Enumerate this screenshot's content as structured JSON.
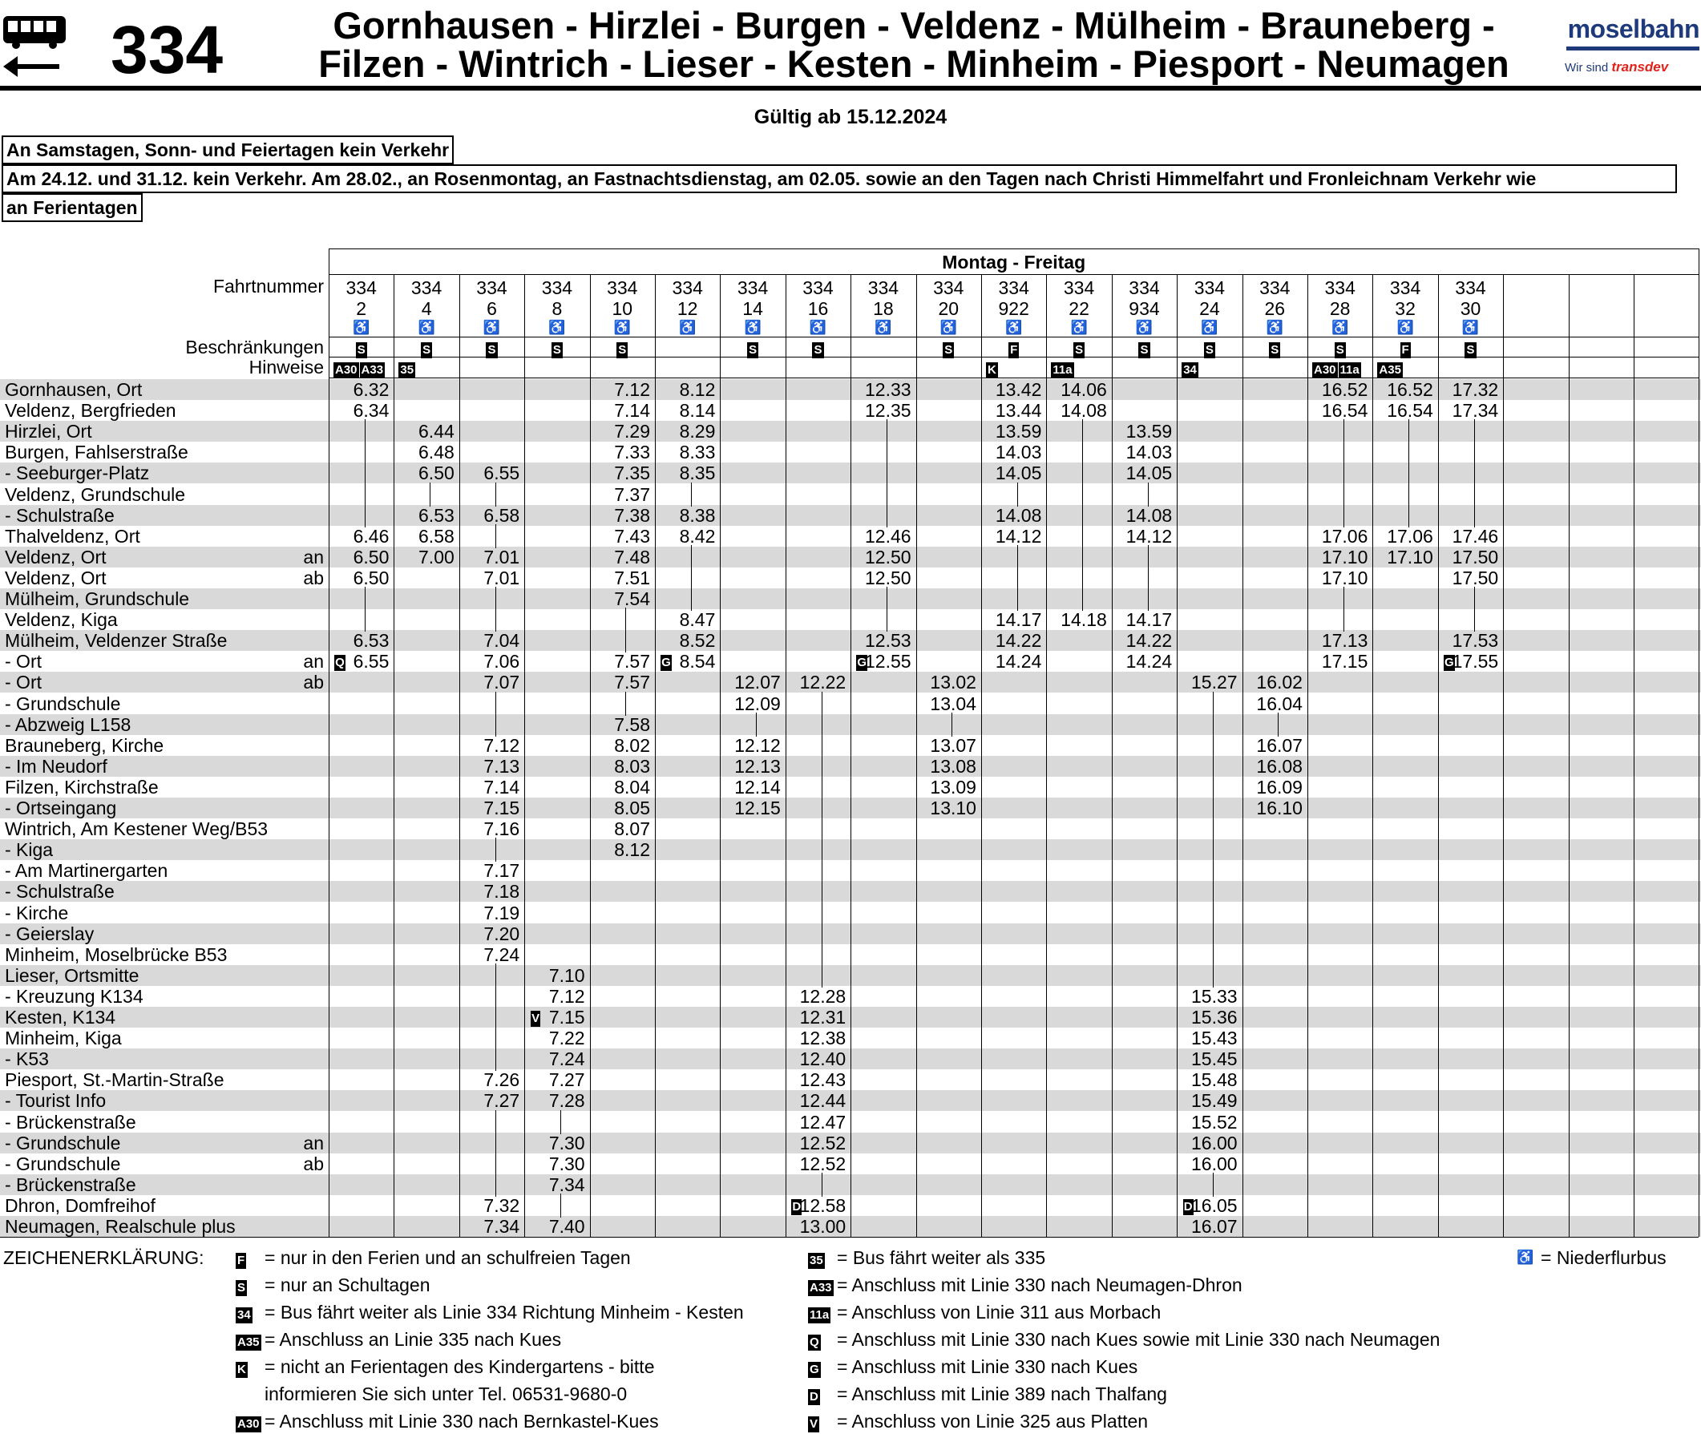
{
  "header": {
    "line_number": "334",
    "route_line1": "Gornhausen - Hirzlei - Burgen - Veldenz - Mülheim - Brauneberg -",
    "route_line2": "Filzen - Wintrich - Lieser - Kesten - Minheim - Piesport - Neumagen",
    "logo_main": "moselbahn",
    "logo_sub": "Wir sind",
    "logo_brand": "transdev",
    "brand_color": "#1f3a7a",
    "accent_color": "#e2231a",
    "icon": "bus-arrow-left-icon"
  },
  "validity": "Gültig ab 15.12.2024",
  "notes": [
    "An Samstagen, Sonn- und Feiertagen kein Verkehr",
    "Am 24.12. und 31.12. kein Verkehr. Am 28.02., an Rosenmontag, an Fastnachtsdienstag, am 02.05. sowie an den Tagen nach Christi Himmelfahrt und Fronleichnam Verkehr wie",
    "an Ferientagen"
  ],
  "timetable": {
    "day_header": "Montag - Freitag",
    "row_labels": {
      "fahrtnummer": "Fahrtnummer",
      "beschraenkungen": "Beschränkungen",
      "hinweise": "Hinweise"
    },
    "lines": [
      "334",
      "334",
      "334",
      "334",
      "334",
      "334",
      "334",
      "334",
      "334",
      "334",
      "334",
      "334",
      "334",
      "334",
      "334",
      "334",
      "334",
      "334"
    ],
    "trips": [
      "2",
      "4",
      "6",
      "8",
      "10",
      "12",
      "14",
      "16",
      "18",
      "20",
      "922",
      "22",
      "934",
      "24",
      "26",
      "28",
      "32",
      "30"
    ],
    "restrictions": [
      "S",
      "S",
      "S",
      "S",
      "S",
      "",
      "S",
      "S",
      "",
      "S",
      "F",
      "S",
      "S",
      "S",
      "S",
      "S",
      "F",
      "S"
    ],
    "hints": [
      [
        "A30",
        "A33"
      ],
      [
        "35"
      ],
      [],
      [],
      [],
      [],
      [],
      [],
      [],
      [],
      [
        "K"
      ],
      [
        "11a"
      ],
      [],
      [
        "34"
      ],
      [],
      [
        "A30",
        "11a"
      ],
      [
        "A35"
      ],
      []
    ],
    "stops": [
      {
        "name": "Gornhausen, Ort",
        "times": [
          "6.32",
          "",
          "",
          "",
          "7.12",
          "8.12",
          "",
          "",
          "12.33",
          "",
          "13.42",
          "14.06",
          "",
          "",
          "",
          "16.52",
          "16.52",
          "17.32"
        ]
      },
      {
        "name": "Veldenz, Bergfrieden",
        "times": [
          "6.34",
          "",
          "",
          "",
          "7.14",
          "8.14",
          "",
          "",
          "12.35",
          "",
          "13.44",
          "14.08",
          "",
          "",
          "",
          "16.54",
          "16.54",
          "17.34"
        ]
      },
      {
        "name": "Hirzlei, Ort",
        "times": [
          "",
          "6.44",
          "",
          "",
          "7.29",
          "8.29",
          "",
          "",
          "",
          "",
          "13.59",
          "",
          "13.59",
          "",
          "",
          "",
          "",
          ""
        ]
      },
      {
        "name": "Burgen, Fahlserstraße",
        "times": [
          "",
          "6.48",
          "",
          "",
          "7.33",
          "8.33",
          "",
          "",
          "",
          "",
          "14.03",
          "",
          "14.03",
          "",
          "",
          "",
          "",
          ""
        ]
      },
      {
        "name": "- Seeburger-Platz",
        "times": [
          "",
          "6.50",
          "6.55",
          "",
          "7.35",
          "8.35",
          "",
          "",
          "",
          "",
          "14.05",
          "",
          "14.05",
          "",
          "",
          "",
          "",
          ""
        ]
      },
      {
        "name": "Veldenz, Grundschule",
        "times": [
          "",
          "",
          "",
          "",
          "7.37",
          "",
          "",
          "",
          "",
          "",
          "",
          "",
          "",
          "",
          "",
          "",
          "",
          ""
        ]
      },
      {
        "name": "- Schulstraße",
        "times": [
          "",
          "6.53",
          "6.58",
          "",
          "7.38",
          "8.38",
          "",
          "",
          "",
          "",
          "14.08",
          "",
          "14.08",
          "",
          "",
          "",
          "",
          ""
        ]
      },
      {
        "name": "Thalveldenz, Ort",
        "times": [
          "6.46",
          "6.58",
          "",
          "",
          "7.43",
          "8.42",
          "",
          "",
          "12.46",
          "",
          "14.12",
          "",
          "14.12",
          "",
          "",
          "17.06",
          "17.06",
          "17.46"
        ]
      },
      {
        "name": "Veldenz, Ort",
        "suffix": "an",
        "times": [
          "6.50",
          "7.00",
          "7.01",
          "",
          "7.48",
          "",
          "",
          "",
          "12.50",
          "",
          "",
          "",
          "",
          "",
          "",
          "17.10",
          "17.10",
          "17.50"
        ]
      },
      {
        "name": "Veldenz, Ort",
        "suffix": "ab",
        "times": [
          "6.50",
          "",
          "7.01",
          "",
          "7.51",
          "",
          "",
          "",
          "12.50",
          "",
          "",
          "",
          "",
          "",
          "",
          "17.10",
          "",
          "17.50"
        ]
      },
      {
        "name": "Mülheim, Grundschule",
        "times": [
          "",
          "",
          "",
          "",
          "7.54",
          "",
          "",
          "",
          "",
          "",
          "",
          "",
          "",
          "",
          "",
          "",
          "",
          ""
        ]
      },
      {
        "name": "Veldenz, Kiga",
        "times": [
          "",
          "",
          "",
          "",
          "",
          "8.47",
          "",
          "",
          "",
          "",
          "14.17",
          "14.18",
          "14.17",
          "",
          "",
          "",
          "",
          ""
        ]
      },
      {
        "name": "Mülheim, Veldenzer Straße",
        "times": [
          "6.53",
          "",
          "7.04",
          "",
          "",
          "8.52",
          "",
          "",
          "12.53",
          "",
          "14.22",
          "",
          "14.22",
          "",
          "",
          "17.13",
          "",
          "17.53"
        ]
      },
      {
        "name": "- Ort",
        "suffix": "an",
        "times": [
          "6.55",
          "",
          "7.06",
          "",
          "7.57",
          "8.54",
          "",
          "",
          "12.55",
          "",
          "14.24",
          "",
          "14.24",
          "",
          "",
          "17.15",
          "",
          "17.55"
        ],
        "marks": {
          "0": "Q",
          "5": "G",
          "8": "G",
          "17": "G"
        }
      },
      {
        "name": "- Ort",
        "suffix": "ab",
        "times": [
          "",
          "",
          "7.07",
          "",
          "7.57",
          "",
          "12.07",
          "12.22",
          "",
          "13.02",
          "",
          "",
          "",
          "15.27",
          "16.02",
          "",
          "",
          ""
        ]
      },
      {
        "name": "- Grundschule",
        "times": [
          "",
          "",
          "",
          "",
          "",
          "",
          "12.09",
          "",
          "",
          "13.04",
          "",
          "",
          "",
          "",
          "16.04",
          "",
          "",
          ""
        ]
      },
      {
        "name": "- Abzweig L158",
        "times": [
          "",
          "",
          "",
          "",
          "7.58",
          "",
          "",
          "",
          "",
          "",
          "",
          "",
          "",
          "",
          "",
          "",
          "",
          ""
        ]
      },
      {
        "name": "Brauneberg, Kirche",
        "times": [
          "",
          "",
          "7.12",
          "",
          "8.02",
          "",
          "12.12",
          "",
          "",
          "13.07",
          "",
          "",
          "",
          "",
          "16.07",
          "",
          "",
          ""
        ]
      },
      {
        "name": "- Im Neudorf",
        "times": [
          "",
          "",
          "7.13",
          "",
          "8.03",
          "",
          "12.13",
          "",
          "",
          "13.08",
          "",
          "",
          "",
          "",
          "16.08",
          "",
          "",
          ""
        ]
      },
      {
        "name": "Filzen, Kirchstraße",
        "times": [
          "",
          "",
          "7.14",
          "",
          "8.04",
          "",
          "12.14",
          "",
          "",
          "13.09",
          "",
          "",
          "",
          "",
          "16.09",
          "",
          "",
          ""
        ]
      },
      {
        "name": "- Ortseingang",
        "times": [
          "",
          "",
          "7.15",
          "",
          "8.05",
          "",
          "12.15",
          "",
          "",
          "13.10",
          "",
          "",
          "",
          "",
          "16.10",
          "",
          "",
          ""
        ]
      },
      {
        "name": "Wintrich, Am Kestener Weg/B53",
        "times": [
          "",
          "",
          "7.16",
          "",
          "8.07",
          "",
          "",
          "",
          "",
          "",
          "",
          "",
          "",
          "",
          "",
          "",
          "",
          ""
        ]
      },
      {
        "name": "- Kiga",
        "times": [
          "",
          "",
          "",
          "",
          "8.12",
          "",
          "",
          "",
          "",
          "",
          "",
          "",
          "",
          "",
          "",
          "",
          "",
          ""
        ]
      },
      {
        "name": "- Am Martinergarten",
        "times": [
          "",
          "",
          "7.17",
          "",
          "",
          "",
          "",
          "",
          "",
          "",
          "",
          "",
          "",
          "",
          "",
          "",
          "",
          ""
        ]
      },
      {
        "name": "- Schulstraße",
        "times": [
          "",
          "",
          "7.18",
          "",
          "",
          "",
          "",
          "",
          "",
          "",
          "",
          "",
          "",
          "",
          "",
          "",
          "",
          ""
        ]
      },
      {
        "name": "- Kirche",
        "times": [
          "",
          "",
          "7.19",
          "",
          "",
          "",
          "",
          "",
          "",
          "",
          "",
          "",
          "",
          "",
          "",
          "",
          "",
          ""
        ]
      },
      {
        "name": "- Geierslay",
        "times": [
          "",
          "",
          "7.20",
          "",
          "",
          "",
          "",
          "",
          "",
          "",
          "",
          "",
          "",
          "",
          "",
          "",
          "",
          ""
        ]
      },
      {
        "name": "Minheim, Moselbrücke B53",
        "times": [
          "",
          "",
          "7.24",
          "",
          "",
          "",
          "",
          "",
          "",
          "",
          "",
          "",
          "",
          "",
          "",
          "",
          "",
          ""
        ]
      },
      {
        "name": "Lieser, Ortsmitte",
        "times": [
          "",
          "",
          "",
          "7.10",
          "",
          "",
          "",
          "",
          "",
          "",
          "",
          "",
          "",
          "",
          "",
          "",
          "",
          ""
        ]
      },
      {
        "name": "- Kreuzung K134",
        "times": [
          "",
          "",
          "",
          "7.12",
          "",
          "",
          "",
          "12.28",
          "",
          "",
          "",
          "",
          "",
          "15.33",
          "",
          "",
          "",
          ""
        ]
      },
      {
        "name": "Kesten, K134",
        "times": [
          "",
          "",
          "",
          "7.15",
          "",
          "",
          "",
          "12.31",
          "",
          "",
          "",
          "",
          "",
          "15.36",
          "",
          "",
          "",
          ""
        ],
        "marks": {
          "3": "V"
        }
      },
      {
        "name": "Minheim, Kiga",
        "times": [
          "",
          "",
          "",
          "7.22",
          "",
          "",
          "",
          "12.38",
          "",
          "",
          "",
          "",
          "",
          "15.43",
          "",
          "",
          "",
          ""
        ]
      },
      {
        "name": "- K53",
        "times": [
          "",
          "",
          "",
          "7.24",
          "",
          "",
          "",
          "12.40",
          "",
          "",
          "",
          "",
          "",
          "15.45",
          "",
          "",
          "",
          ""
        ]
      },
      {
        "name": "Piesport, St.-Martin-Straße",
        "times": [
          "",
          "",
          "7.26",
          "7.27",
          "",
          "",
          "",
          "12.43",
          "",
          "",
          "",
          "",
          "",
          "15.48",
          "",
          "",
          "",
          ""
        ]
      },
      {
        "name": "- Tourist Info",
        "times": [
          "",
          "",
          "7.27",
          "7.28",
          "",
          "",
          "",
          "12.44",
          "",
          "",
          "",
          "",
          "",
          "15.49",
          "",
          "",
          "",
          ""
        ]
      },
      {
        "name": "- Brückenstraße",
        "times": [
          "",
          "",
          "",
          "",
          "",
          "",
          "",
          "12.47",
          "",
          "",
          "",
          "",
          "",
          "15.52",
          "",
          "",
          "",
          ""
        ]
      },
      {
        "name": "- Grundschule",
        "suffix": "an",
        "times": [
          "",
          "",
          "",
          "7.30",
          "",
          "",
          "",
          "12.52",
          "",
          "",
          "",
          "",
          "",
          "16.00",
          "",
          "",
          "",
          ""
        ]
      },
      {
        "name": "- Grundschule",
        "suffix": "ab",
        "times": [
          "",
          "",
          "",
          "7.30",
          "",
          "",
          "",
          "12.52",
          "",
          "",
          "",
          "",
          "",
          "16.00",
          "",
          "",
          "",
          ""
        ]
      },
      {
        "name": "- Brückenstraße",
        "times": [
          "",
          "",
          "",
          "7.34",
          "",
          "",
          "",
          "",
          "",
          "",
          "",
          "",
          "",
          "",
          "",
          "",
          "",
          ""
        ]
      },
      {
        "name": "Dhron, Domfreihof",
        "times": [
          "",
          "",
          "7.32",
          "",
          "",
          "",
          "",
          "12.58",
          "",
          "",
          "",
          "",
          "",
          "16.05",
          "",
          "",
          "",
          ""
        ],
        "marks": {
          "7": "D",
          "13": "D"
        }
      },
      {
        "name": "Neumagen, Realschule plus",
        "times": [
          "",
          "",
          "7.34",
          "7.40",
          "",
          "",
          "",
          "13.00",
          "",
          "",
          "",
          "",
          "",
          "16.07",
          "",
          "",
          "",
          ""
        ]
      }
    ]
  },
  "legend": {
    "title": "ZEICHENERKLÄRUNG:",
    "left": [
      {
        "sym": "F",
        "text": "= nur in den Ferien und an schulfreien Tagen"
      },
      {
        "sym": "S",
        "text": "= nur an Schultagen"
      },
      {
        "sym": "34",
        "text": "= Bus fährt weiter als Linie 334 Richtung Minheim - Kesten"
      },
      {
        "sym": "A35",
        "text": "= Anschluss an Linie 335 nach Kues"
      },
      {
        "sym": "K",
        "text": "= nicht an Ferientagen des Kindergartens - bitte"
      },
      {
        "sym": "",
        "text": "informieren Sie sich unter Tel. 06531-9680-0"
      },
      {
        "sym": "A30",
        "text": "= Anschluss mit Linie 330 nach Bernkastel-Kues"
      }
    ],
    "right": [
      {
        "sym": "35",
        "text": "= Bus fährt weiter als 335"
      },
      {
        "sym": "A33",
        "text": "= Anschluss mit Linie 330 nach Neumagen-Dhron"
      },
      {
        "sym": "11a",
        "text": "= Anschluss von Linie 311 aus Morbach"
      },
      {
        "sym": "Q",
        "text": "= Anschluss mit Linie 330 nach Kues sowie mit Linie 330 nach Neumagen"
      },
      {
        "sym": "G",
        "text": "= Anschluss mit Linie 330 nach Kues"
      },
      {
        "sym": "D",
        "text": "= Anschluss mit Linie 389 nach Thalfang"
      },
      {
        "sym": "V",
        "text": "= Anschluss von Linie 325 aus Platten"
      }
    ],
    "wheelchair": "= Niederflurbus",
    "wheelchair_icon": "wheelchair-icon"
  }
}
